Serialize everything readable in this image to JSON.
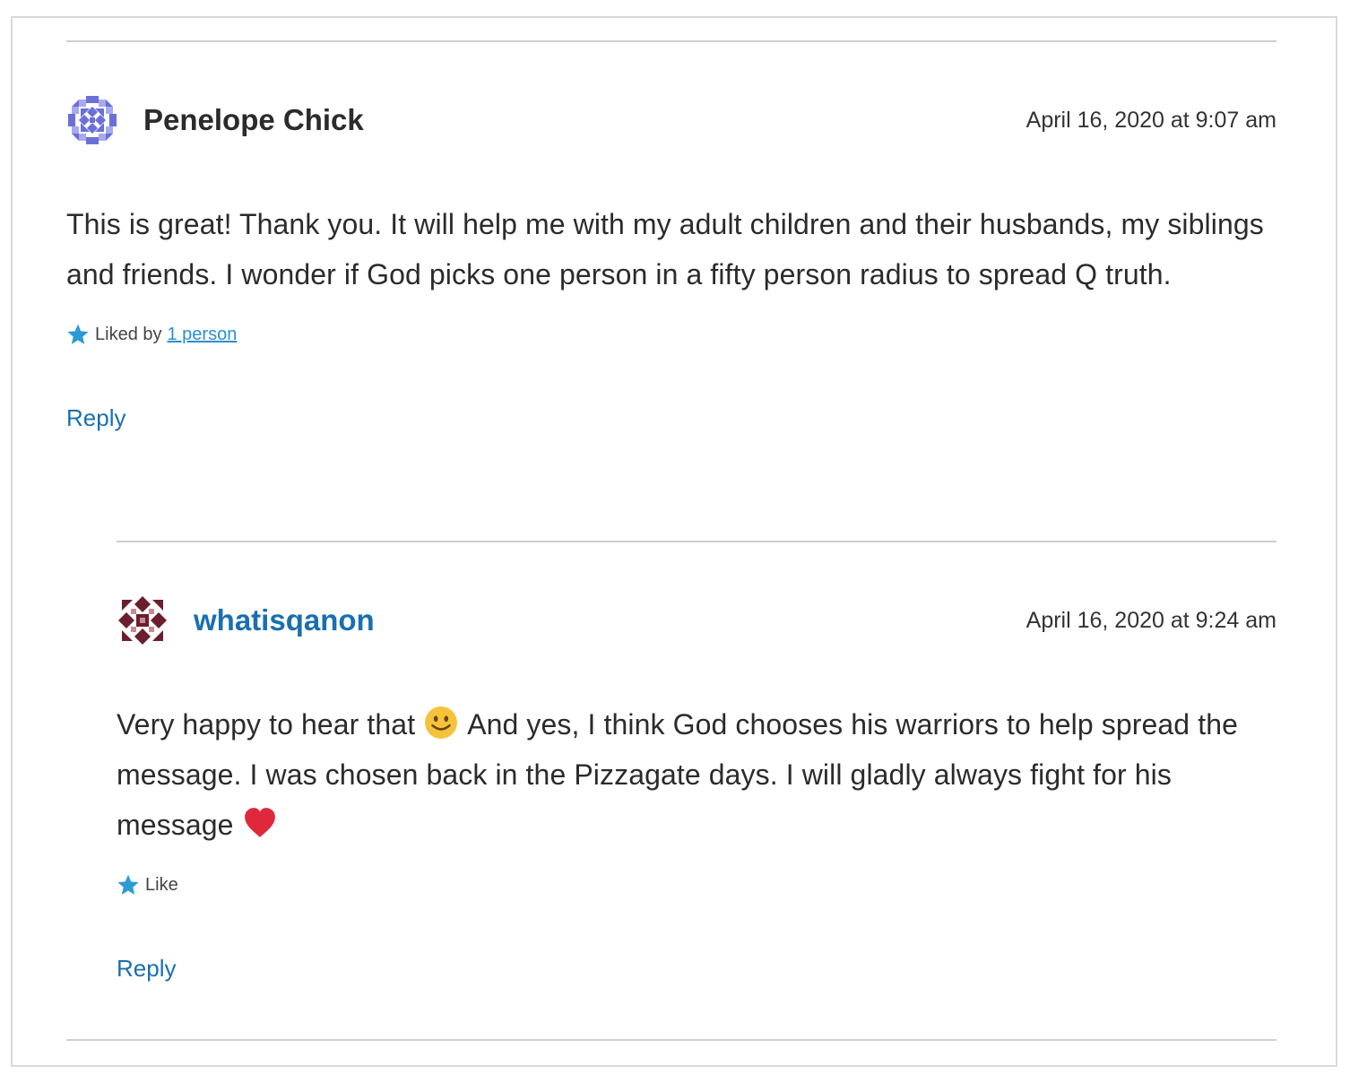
{
  "comments": [
    {
      "author": "Penelope Chick",
      "date": "April 16, 2020 at 9:07 am",
      "text": "This is great! Thank you. It will help me with my adult children and their husbands, my siblings and friends. I wonder if God picks one person in a fifty person radius to spread Q truth.",
      "likes_prefix": "Liked by",
      "likes_link": "1 person",
      "reply_label": "Reply",
      "avatar_color": "#6b6fd8"
    },
    {
      "author": "whatisqanon",
      "date": "April 16, 2020 at 9:24 am",
      "text_part1": "Very happy to hear that",
      "text_part2": "And yes, I think God chooses his warriors to help spread the message. I was chosen back in the Pizzagate days. I will gladly always fight for his message",
      "like_label": "Like",
      "reply_label": "Reply",
      "avatar_color": "#6b1f2e"
    }
  ],
  "colors": {
    "link": "#1a6fb0",
    "star": "#2b9bd6",
    "rule": "#cfcfcf",
    "heart": "#e0283c",
    "smiley": "#f5c33b"
  },
  "icons": {
    "star": "star-icon",
    "smiley": "smiley-emoji-icon",
    "heart": "heart-emoji-icon"
  }
}
